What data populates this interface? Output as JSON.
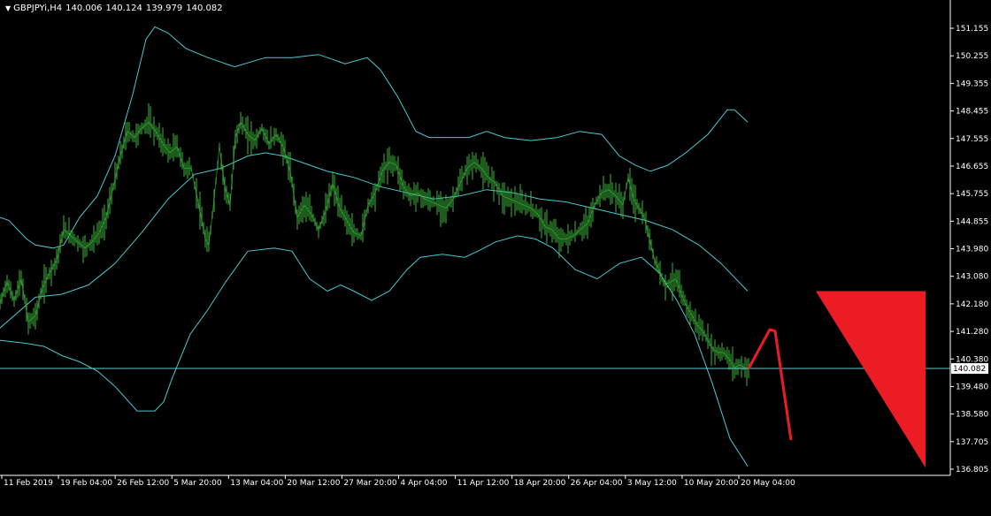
{
  "header": {
    "symbol": "GBPJPYi,H4",
    "open": "140.006",
    "high": "140.124",
    "low": "139.979",
    "close": "140.082"
  },
  "price_label": "140.082",
  "colors": {
    "background": "#000000",
    "candles": "#3cb83c",
    "bands": "#46c8d2",
    "price_line": "#5fc8d2",
    "projection": "#ec1c24",
    "axis": "#ffffff"
  },
  "chart_data": {
    "type": "line",
    "y_ticks": [
      "151.155",
      "150.255",
      "149.355",
      "148.455",
      "147.555",
      "146.655",
      "145.755",
      "144.855",
      "143.980",
      "143.080",
      "142.180",
      "141.280",
      "140.380",
      "139.480",
      "138.580",
      "137.705",
      "136.805"
    ],
    "x_ticks": [
      "11 Feb 2019",
      "19 Feb 04:00",
      "26 Feb 12:00",
      "5 Mar 20:00",
      "13 Mar 04:00",
      "20 Mar 12:00",
      "27 Mar 20:00",
      "4 Apr 04:00",
      "11 Apr 12:00",
      "18 Apr 20:00",
      "26 Apr 04:00",
      "3 May 12:00",
      "10 May 20:00",
      "20 May 04:00"
    ],
    "ylim": [
      136.805,
      151.155
    ],
    "last_price": 140.082,
    "series": [
      {
        "name": "",
        "role": "price",
        "points": [
          [
            0,
            142.2
          ],
          [
            8,
            142.9
          ],
          [
            16,
            142.3
          ],
          [
            24,
            143.0
          ],
          [
            32,
            141.6
          ],
          [
            40,
            141.8
          ],
          [
            48,
            142.7
          ],
          [
            56,
            143.2
          ],
          [
            64,
            143.6
          ],
          [
            72,
            144.6
          ],
          [
            80,
            144.4
          ],
          [
            88,
            144.2
          ],
          [
            96,
            144.0
          ],
          [
            104,
            144.2
          ],
          [
            112,
            144.5
          ],
          [
            120,
            145.0
          ],
          [
            128,
            146.0
          ],
          [
            136,
            147.0
          ],
          [
            144,
            147.8
          ],
          [
            152,
            147.6
          ],
          [
            160,
            147.9
          ],
          [
            168,
            148.1
          ],
          [
            176,
            147.8
          ],
          [
            184,
            147.4
          ],
          [
            192,
            147.1
          ],
          [
            200,
            147.3
          ],
          [
            208,
            146.6
          ],
          [
            216,
            146.6
          ],
          [
            224,
            145.5
          ],
          [
            232,
            144.3
          ],
          [
            236,
            144.1
          ],
          [
            242,
            145.6
          ],
          [
            248,
            147.3
          ],
          [
            254,
            146.0
          ],
          [
            260,
            145.4
          ],
          [
            266,
            147.6
          ],
          [
            272,
            148.1
          ],
          [
            280,
            147.7
          ],
          [
            288,
            147.5
          ],
          [
            296,
            147.9
          ],
          [
            304,
            147.4
          ],
          [
            312,
            147.7
          ],
          [
            320,
            147.3
          ],
          [
            328,
            146.5
          ],
          [
            336,
            145.0
          ],
          [
            344,
            145.4
          ],
          [
            352,
            145.1
          ],
          [
            360,
            144.6
          ],
          [
            368,
            145.2
          ],
          [
            376,
            146.1
          ],
          [
            384,
            145.3
          ],
          [
            392,
            144.9
          ],
          [
            400,
            144.5
          ],
          [
            408,
            144.4
          ],
          [
            416,
            145.4
          ],
          [
            424,
            145.8
          ],
          [
            432,
            146.5
          ],
          [
            440,
            146.8
          ],
          [
            448,
            146.7
          ],
          [
            456,
            146.0
          ],
          [
            464,
            145.7
          ],
          [
            472,
            145.8
          ],
          [
            480,
            145.6
          ],
          [
            488,
            145.5
          ],
          [
            496,
            145.4
          ],
          [
            504,
            145.3
          ],
          [
            512,
            145.6
          ],
          [
            520,
            146.1
          ],
          [
            528,
            146.6
          ],
          [
            536,
            146.8
          ],
          [
            544,
            146.6
          ],
          [
            552,
            146.3
          ],
          [
            560,
            146.1
          ],
          [
            568,
            145.7
          ],
          [
            576,
            145.6
          ],
          [
            584,
            145.5
          ],
          [
            592,
            145.4
          ],
          [
            600,
            145.3
          ],
          [
            608,
            145.1
          ],
          [
            616,
            144.7
          ],
          [
            624,
            144.6
          ],
          [
            632,
            144.3
          ],
          [
            640,
            144.3
          ],
          [
            648,
            144.4
          ],
          [
            656,
            144.6
          ],
          [
            664,
            144.8
          ],
          [
            672,
            145.4
          ],
          [
            680,
            145.8
          ],
          [
            688,
            145.9
          ],
          [
            696,
            145.7
          ],
          [
            704,
            145.4
          ],
          [
            710,
            146.3
          ],
          [
            716,
            145.6
          ],
          [
            722,
            145.3
          ],
          [
            728,
            145.0
          ],
          [
            734,
            144.3
          ],
          [
            740,
            143.6
          ],
          [
            746,
            143.2
          ],
          [
            752,
            142.8
          ],
          [
            758,
            142.9
          ],
          [
            764,
            143.0
          ],
          [
            770,
            142.5
          ],
          [
            776,
            142.1
          ],
          [
            782,
            141.8
          ],
          [
            788,
            141.5
          ],
          [
            794,
            141.3
          ],
          [
            800,
            141.0
          ],
          [
            806,
            140.7
          ],
          [
            812,
            140.6
          ],
          [
            818,
            140.6
          ],
          [
            824,
            140.4
          ],
          [
            830,
            140.1
          ],
          [
            836,
            140.2
          ],
          [
            842,
            140.1
          ],
          [
            846,
            140.08
          ]
        ]
      },
      {
        "name": "",
        "role": "middle-band",
        "points": [
          [
            0,
            141.4
          ],
          [
            40,
            142.4
          ],
          [
            70,
            142.5
          ],
          [
            100,
            142.8
          ],
          [
            130,
            143.5
          ],
          [
            160,
            144.5
          ],
          [
            190,
            145.6
          ],
          [
            220,
            146.4
          ],
          [
            250,
            146.6
          ],
          [
            280,
            147.0
          ],
          [
            300,
            147.1
          ],
          [
            320,
            147.0
          ],
          [
            340,
            146.8
          ],
          [
            370,
            146.5
          ],
          [
            400,
            146.3
          ],
          [
            430,
            146.0
          ],
          [
            460,
            145.8
          ],
          [
            490,
            145.6
          ],
          [
            520,
            145.7
          ],
          [
            550,
            145.9
          ],
          [
            580,
            145.8
          ],
          [
            610,
            145.6
          ],
          [
            640,
            145.5
          ],
          [
            670,
            145.3
          ],
          [
            700,
            145.1
          ],
          [
            730,
            144.9
          ],
          [
            760,
            144.6
          ],
          [
            790,
            144.1
          ],
          [
            815,
            143.5
          ],
          [
            845,
            142.6
          ]
        ]
      },
      {
        "name": "",
        "role": "upper-band",
        "points": [
          [
            0,
            145.0
          ],
          [
            10,
            144.9
          ],
          [
            20,
            144.6
          ],
          [
            30,
            144.3
          ],
          [
            40,
            144.1
          ],
          [
            60,
            144.0
          ],
          [
            72,
            144.1
          ],
          [
            90,
            145.0
          ],
          [
            110,
            145.7
          ],
          [
            130,
            147.0
          ],
          [
            150,
            149.0
          ],
          [
            165,
            150.8
          ],
          [
            175,
            151.2
          ],
          [
            190,
            151.0
          ],
          [
            210,
            150.5
          ],
          [
            235,
            150.2
          ],
          [
            265,
            149.9
          ],
          [
            300,
            150.2
          ],
          [
            330,
            150.2
          ],
          [
            360,
            150.3
          ],
          [
            390,
            150.0
          ],
          [
            415,
            150.2
          ],
          [
            430,
            149.8
          ],
          [
            450,
            148.9
          ],
          [
            470,
            147.8
          ],
          [
            485,
            147.6
          ],
          [
            510,
            147.6
          ],
          [
            530,
            147.6
          ],
          [
            550,
            147.8
          ],
          [
            570,
            147.6
          ],
          [
            600,
            147.5
          ],
          [
            630,
            147.6
          ],
          [
            655,
            147.8
          ],
          [
            680,
            147.7
          ],
          [
            700,
            147.0
          ],
          [
            718,
            146.7
          ],
          [
            735,
            146.5
          ],
          [
            755,
            146.7
          ],
          [
            775,
            147.1
          ],
          [
            800,
            147.7
          ],
          [
            822,
            148.5
          ],
          [
            830,
            148.5
          ],
          [
            845,
            148.1
          ]
        ]
      },
      {
        "name": "",
        "role": "lower-band",
        "points": [
          [
            0,
            141.0
          ],
          [
            30,
            140.9
          ],
          [
            50,
            140.8
          ],
          [
            70,
            140.5
          ],
          [
            90,
            140.3
          ],
          [
            110,
            140.0
          ],
          [
            130,
            139.5
          ],
          [
            155,
            138.7
          ],
          [
            175,
            138.7
          ],
          [
            185,
            139.0
          ],
          [
            195,
            139.8
          ],
          [
            215,
            141.2
          ],
          [
            235,
            142.0
          ],
          [
            255,
            142.9
          ],
          [
            280,
            143.9
          ],
          [
            310,
            144.0
          ],
          [
            330,
            143.9
          ],
          [
            350,
            143.0
          ],
          [
            370,
            142.6
          ],
          [
            385,
            142.8
          ],
          [
            400,
            142.6
          ],
          [
            420,
            142.3
          ],
          [
            440,
            142.6
          ],
          [
            460,
            143.3
          ],
          [
            475,
            143.7
          ],
          [
            500,
            143.8
          ],
          [
            525,
            143.7
          ],
          [
            540,
            143.9
          ],
          [
            560,
            144.2
          ],
          [
            585,
            144.4
          ],
          [
            605,
            144.3
          ],
          [
            625,
            144.0
          ],
          [
            650,
            143.3
          ],
          [
            675,
            143.0
          ],
          [
            700,
            143.5
          ],
          [
            725,
            143.7
          ],
          [
            745,
            143.2
          ],
          [
            765,
            142.3
          ],
          [
            785,
            141.2
          ],
          [
            805,
            139.6
          ],
          [
            825,
            137.8
          ],
          [
            845,
            136.9
          ]
        ]
      },
      {
        "name": "",
        "role": "projection",
        "points": [
          [
            846,
            140.08
          ],
          [
            870,
            141.35
          ],
          [
            876,
            141.3
          ],
          [
            894,
            137.75
          ]
        ]
      }
    ],
    "annotation": {
      "shape": "triangle",
      "points": [
        [
          922,
          142.6
        ],
        [
          1046,
          142.6
        ],
        [
          1046,
          136.85
        ]
      ]
    },
    "grid": false
  }
}
